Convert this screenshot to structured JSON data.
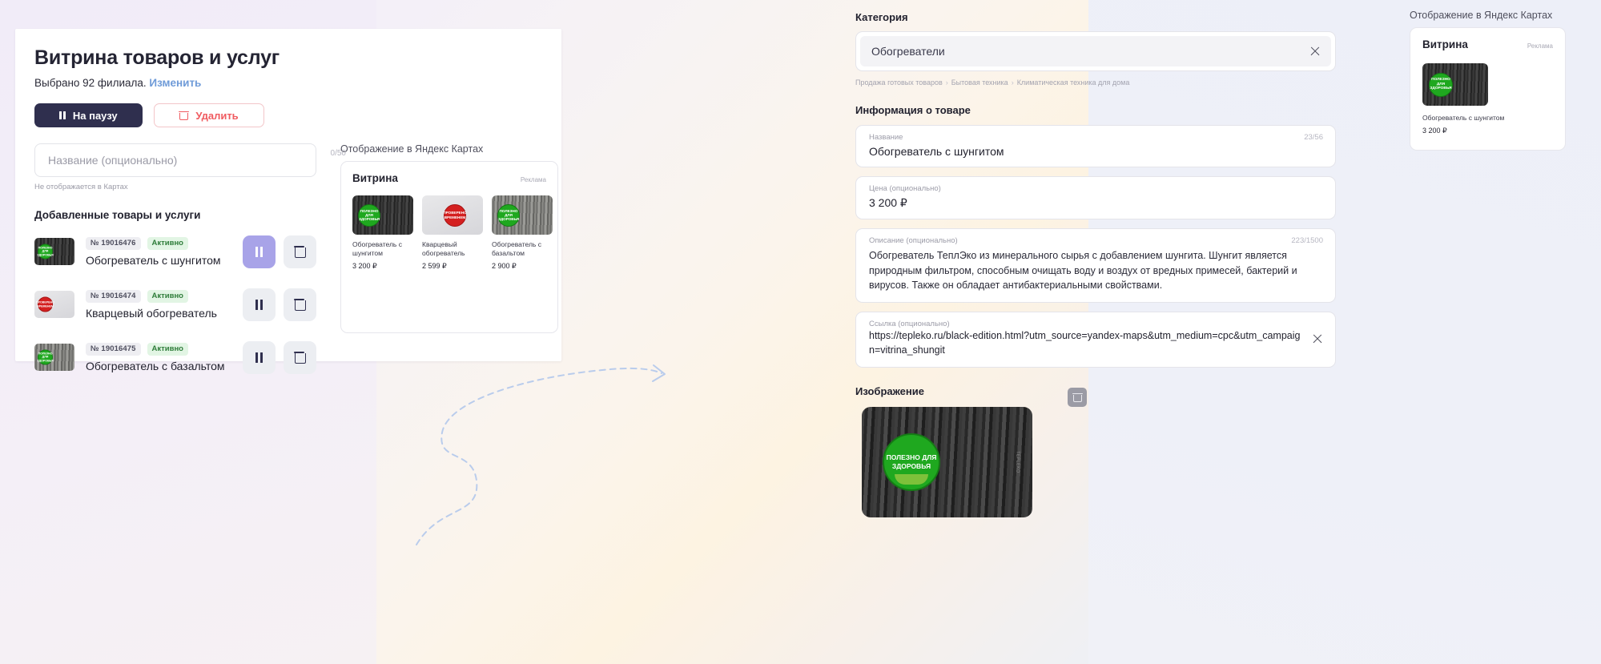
{
  "left_card": {
    "title": "Витрина товаров и услуг",
    "subtitle_text": "Выбрано 92 филиала.",
    "subtitle_link": "Изменить",
    "buttons": {
      "pause": "На паузу",
      "delete": "Удалить"
    },
    "name_field": {
      "placeholder": "Название (опционально)",
      "counter": "0/50",
      "hint": "Не отображается в Картах"
    },
    "list_heading": "Добавленные товары и услуги",
    "products": [
      {
        "id": "№ 19016476",
        "status": "Активно",
        "name": "Обогреватель с шунгитом",
        "badge": "ПОЛЕЗНО ДЛЯ ЗДОРОВЬЯ",
        "thumb": "dark",
        "action": "pause-active"
      },
      {
        "id": "№ 19016474",
        "status": "Активно",
        "name": "Кварцевый обогреватель",
        "badge": "ПРОВЕРЕНО ВРЕМЕНЕМ",
        "thumb": "light",
        "action": "pause"
      },
      {
        "id": "№ 19016475",
        "status": "Активно",
        "name": "Обогреватель с базальтом",
        "badge": "ПОЛЕЗНО ДЛЯ ЗДОРОВЬЯ",
        "thumb": "gray",
        "action": "pause"
      }
    ],
    "preview": {
      "label": "Отображение в Яндекс Картах",
      "card_title": "Витрина",
      "ad_label": "Реклама",
      "items": [
        {
          "name": "Обогреватель с шунгитом",
          "price": "3 200 ₽",
          "thumb": "dark"
        },
        {
          "name": "Кварцевый обогреватель",
          "price": "2 599 ₽",
          "thumb": "light"
        },
        {
          "name": "Обогреватель с базальтом",
          "price": "2 900 ₽",
          "thumb": "gray"
        }
      ]
    }
  },
  "right_panel": {
    "category_label": "Категория",
    "category_value": "Обогреватели",
    "breadcrumb": [
      "Продажа готовых товаров",
      "Бытовая техника",
      "Климатическая техника для дома"
    ],
    "info_heading": "Информация о товаре",
    "name_field": {
      "label": "Название",
      "value": "Обогреватель с шунгитом",
      "counter": "23/56"
    },
    "price_field": {
      "label": "Цена (опционально)",
      "value": "3 200 ₽"
    },
    "desc_field": {
      "label": "Описание (опционально)",
      "counter": "223/1500",
      "value": "Обогреватель ТеплЭко из минерального сырья с добавлением шунгита. Шунгит является природным фильтром, способным очищать воду и воздух от вредных примесей, бактерий и вирусов. Также он обладает антибактериальными свойствами."
    },
    "link_field": {
      "label": "Ссылка (опционально)",
      "value": "https://tepleko.ru/black-edition.html?utm_source=yandex-maps&utm_medium=cpc&utm_campaign=vitrina_shungit"
    },
    "image_heading": "Изображение",
    "image_badge": "ПОЛЕЗНО ДЛЯ ЗДОРОВЬЯ",
    "image_watermark": "TEPLEKO"
  },
  "far_right_preview": {
    "label": "Отображение в Яндекс Картах",
    "card_title": "Витрина",
    "ad_label": "Реклама",
    "item": {
      "name": "Обогреватель с шунгитом",
      "price": "3 200 ₽",
      "badge": "ПОЛЕЗНО ДЛЯ ЗДОРОВЬЯ"
    }
  },
  "colors": {
    "accent_dark": "#2f2f4e",
    "danger": "#f05b60",
    "link": "#6f9bd8",
    "violet": "#a8a3e8",
    "status_green_bg": "#e2f5e4",
    "status_green_fg": "#2f7d3a"
  }
}
